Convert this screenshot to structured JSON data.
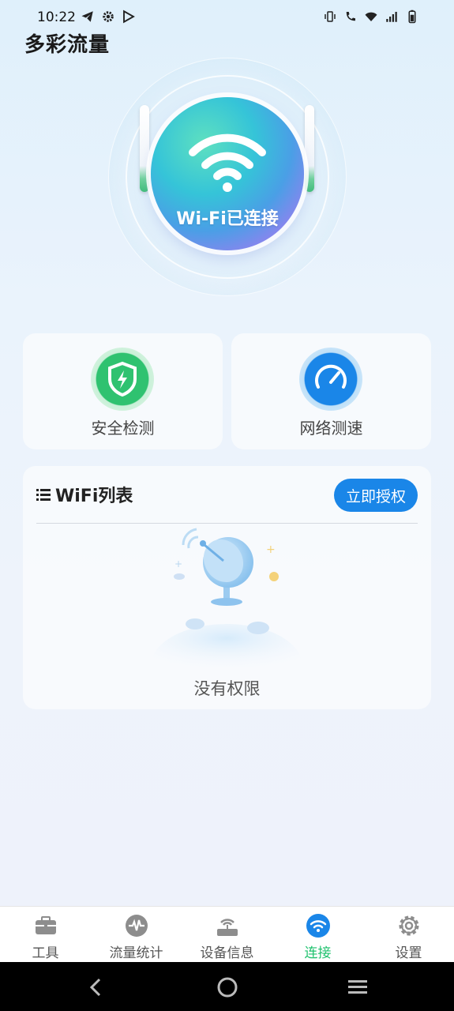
{
  "status_bar": {
    "time": "10:22"
  },
  "app": {
    "title": "多彩流量"
  },
  "hero": {
    "status_label": "Wi-Fi已连接"
  },
  "features": [
    {
      "label": "安全检测",
      "icon": "shield-bolt-icon",
      "color": "#2fc270"
    },
    {
      "label": "网络测速",
      "icon": "speedometer-icon",
      "color": "#1a86e8"
    }
  ],
  "wifi_list": {
    "title": "WiFi列表",
    "auth_button": "立即授权",
    "empty_text": "没有权限"
  },
  "bottom_nav": {
    "items": [
      {
        "label": "工具",
        "icon": "toolbox-icon"
      },
      {
        "label": "流量统计",
        "icon": "pulse-icon"
      },
      {
        "label": "设备信息",
        "icon": "router-icon"
      },
      {
        "label": "连接",
        "icon": "wifi-icon",
        "active": true
      },
      {
        "label": "设置",
        "icon": "gear-icon"
      }
    ]
  },
  "colors": {
    "accent": "#1ec16d",
    "primary": "#1a86e8"
  }
}
